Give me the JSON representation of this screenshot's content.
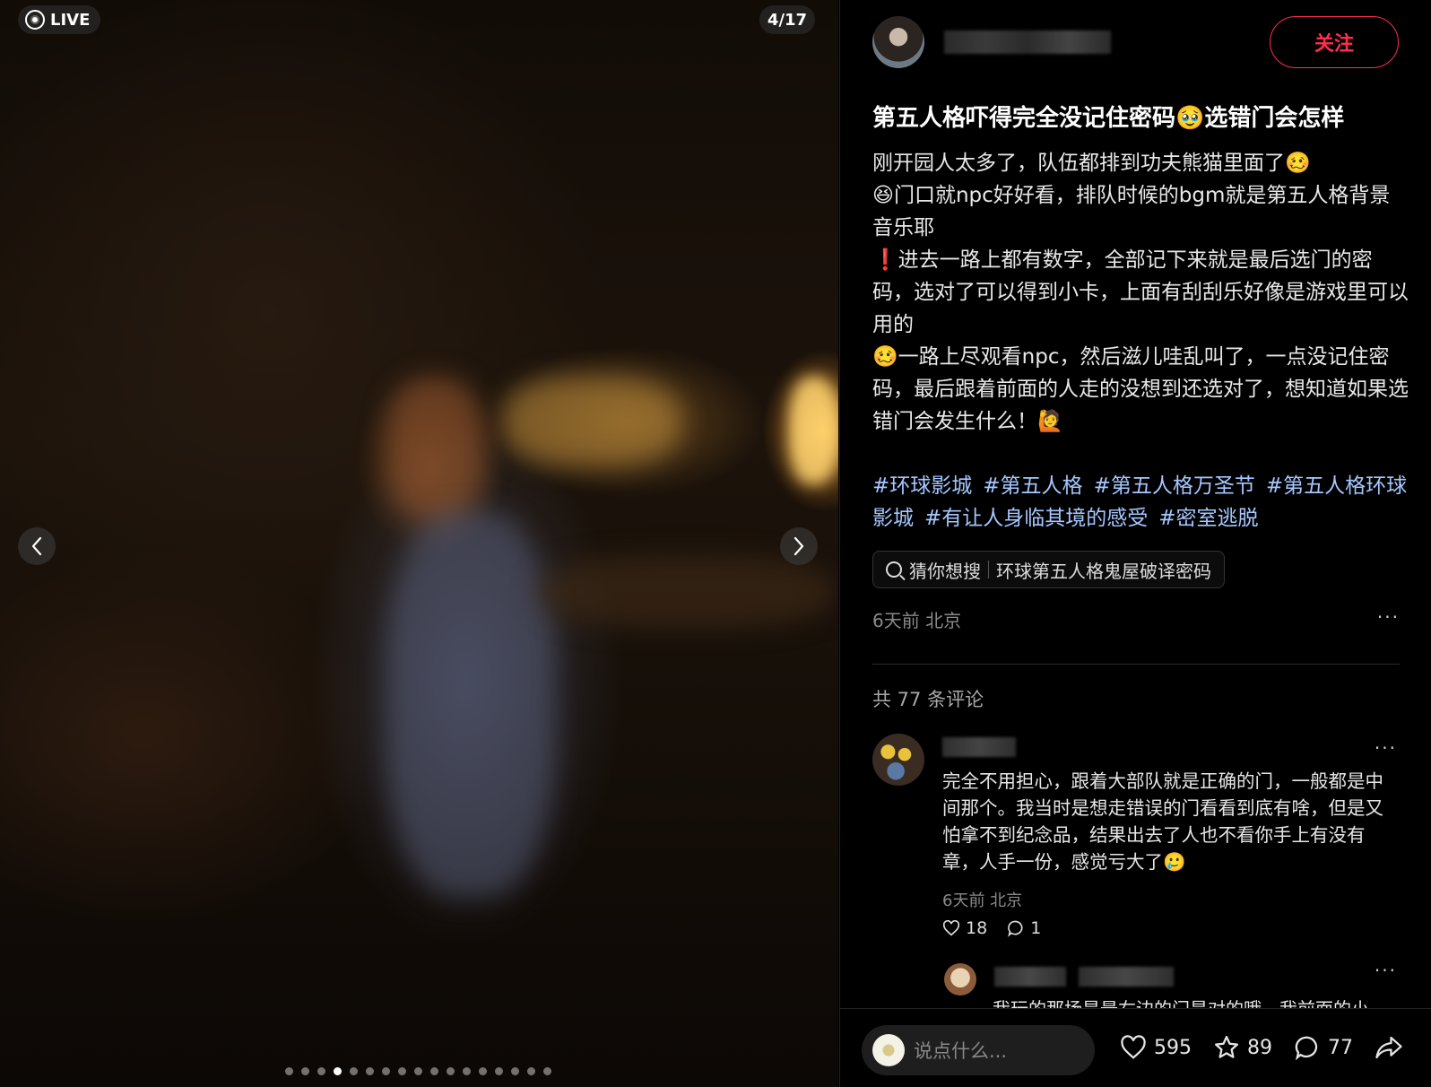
{
  "media": {
    "live_label": "LIVE",
    "counter": "4/17",
    "total_dots": 17,
    "active_dot": 4,
    "prev_icon": "‹",
    "next_icon": "›"
  },
  "author": {
    "follow_label": "关注"
  },
  "post": {
    "title": "第五人格吓得完全没记住密码🥹选错门会怎样",
    "paragraphs": [
      "刚开园人太多了，队伍都排到功夫熊猫里面了🥴",
      "😆门口就npc好好看，排队时候的bgm就是第五人格背景音乐耶",
      "❗进去一路上都有数字，全部记下来就是最后选门的密码，选对了可以得到小卡，上面有刮刮乐好像是游戏里可以用的",
      "🥴一路上尽观看npc，然后滋儿哇乱叫了，一点没记住密码，最后跟着前面的人走的没想到还选对了，想知道如果选错门会发生什么！🙋"
    ],
    "tags": [
      "#环球影城",
      "#第五人格",
      "#第五人格万圣节",
      "#第五人格环球影城",
      "#有让人身临其境的感受",
      "#密室逃脱"
    ],
    "search_hint_label": "猜你想搜",
    "search_hint_query": "环球第五人格鬼屋破译密码",
    "time_location": "6天前  北京",
    "more": "···"
  },
  "comments": {
    "count_label": "共 77 条评论",
    "first": {
      "text": "完全不用担心，跟着大部队就是正确的门，一般都是中间那个。我当时是想走错误的门看看到底有啥，但是又怕拿不到纪念品，结果出去了人也不看你手上有没有章，人手一份，感觉亏大了🥲",
      "meta": "6天前 北京",
      "likes": "18",
      "replies": "1",
      "more": "···"
    },
    "reply": {
      "text": "我玩的那场是最右边的门是对的哦，我前面的小",
      "more": "···"
    }
  },
  "bottom": {
    "input_placeholder": "说点什么...",
    "likes": "595",
    "stars": "89",
    "comments": "77"
  },
  "colors": {
    "accent": "#ff2e4d",
    "tag": "#a5c7ff"
  }
}
